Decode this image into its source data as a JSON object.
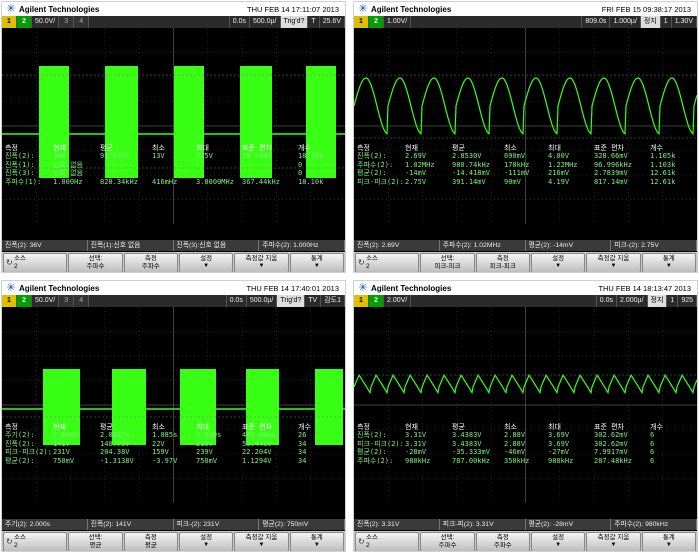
{
  "brand": "Agilent Technologies",
  "screens": [
    {
      "datetime": "THU FEB 14 17:11:07 2013",
      "status": {
        "ch1": "1",
        "ch2": "2",
        "ch2_scale": "50.0V/",
        "ch3": "3",
        "ch4": "4",
        "trig_delay": "0.0s",
        "timebase": "500.0",
        "timebase_unit": "µ/",
        "trig": "Trig'd?",
        "ch_icon": "T",
        "right": "25.6V"
      },
      "measure": {
        "header": [
          "측정",
          "현재",
          "평균",
          "최소",
          "최대",
          "표준 편차",
          "개수"
        ],
        "rows": [
          [
            "진폭(2):",
            "36V",
            "91.425V",
            "13V",
            "225V",
            "19.730V",
            "18.95k"
          ],
          [
            "진폭(1):",
            "신호 없음",
            "",
            "",
            "",
            "",
            "0"
          ],
          [
            "진폭(3):",
            "신호 없음",
            "",
            "",
            "",
            "",
            "0"
          ],
          [
            "주파수(1):",
            "1.000Hz",
            "828.34kHz",
            "416mHz",
            "3.8000MHz",
            "367.44kHz",
            "18.10k"
          ]
        ]
      },
      "readout": [
        "진폭(2): 36V",
        "진폭(1):신호 없음",
        "진폭(3):신호 없음",
        "주파수(2): 1.000Hz"
      ],
      "softkeys": [
        {
          "l1": "소스",
          "l2": "2"
        },
        {
          "l1": "선택:",
          "l2": "주파수"
        },
        {
          "l1": "측정",
          "l2": "주파수"
        },
        {
          "l1": "설정",
          "l2": ""
        },
        {
          "l1": "측정값 지움",
          "l2": ""
        },
        {
          "l1": "통계",
          "l2": ""
        }
      ]
    },
    {
      "datetime": "FRI FEB 15 09:38:17 2013",
      "status": {
        "ch1": "1",
        "ch2": "2",
        "ch2_scale": "1.00V/",
        "ch3": "",
        "ch4": "",
        "trig_delay": "809.0s",
        "timebase": "1.000",
        "timebase_unit": "µ/",
        "trig": "정지",
        "ch_icon": "1",
        "right": "1.30V"
      },
      "measure": {
        "header": [
          "측정",
          "현재",
          "평균",
          "최소",
          "최대",
          "표준 편차",
          "개수"
        ],
        "rows": [
          [
            "진폭(2):",
            "2.69V",
            "2.8530V",
            "690mV",
            "4.00V",
            "328.66mV",
            "1.105k"
          ],
          [
            "주파수(2):",
            "1.02MHz",
            "980.74kHz",
            "170kHz",
            "1.22MHz",
            "96.996kHz",
            "1.103k"
          ],
          [
            "평균(2):",
            "-14mV",
            "-14.418mV",
            "-111mV",
            "216mV",
            "2.7839mV",
            "12.61k"
          ],
          [
            "피크-피크(2):",
            "2.75V",
            "391.14mV",
            "90mV",
            "4.19V",
            "817.14mV",
            "12.61k"
          ]
        ]
      },
      "readout": [
        "진폭(2): 2.69V",
        "주파수(2): 1.02MHz",
        "평균(2): -14mV",
        "피크-(2): 2.75V"
      ],
      "softkeys": [
        {
          "l1": "소스",
          "l2": "2"
        },
        {
          "l1": "선택:",
          "l2": "피크-피크"
        },
        {
          "l1": "측정",
          "l2": "피크-피크"
        },
        {
          "l1": "설정",
          "l2": ""
        },
        {
          "l1": "측정값 지움",
          "l2": ""
        },
        {
          "l1": "통계",
          "l2": ""
        }
      ]
    },
    {
      "datetime": "THU FEB 14 17:40:01 2013",
      "status": {
        "ch1": "1",
        "ch2": "2",
        "ch2_scale": "50.0V/",
        "ch3": "3",
        "ch4": "4",
        "trig_delay": "0.0s",
        "timebase": "500.0",
        "timebase_unit": "µ/",
        "trig": "Trig'd?",
        "ch_icon": "TV",
        "right": "감도1"
      },
      "measure": {
        "header": [
          "측정",
          "현재",
          "평균",
          "최소",
          "최대",
          "표준 편차",
          "개수"
        ],
        "rows": [
          [
            "주기(2):",
            "2.000s",
            "2.0827s",
            "1.085s",
            "3.010s",
            "403.06ms",
            "26"
          ],
          [
            "진폭(2):",
            "141V",
            "140.79V",
            "22V",
            "219V",
            "55.445V",
            "34"
          ],
          [
            "피크-피크(2):",
            "231V",
            "204.38V",
            "159V",
            "239V",
            "22.204V",
            "34"
          ],
          [
            "평균(2):",
            "750mV",
            "-1.3138V",
            "-3.97V",
            "750mV",
            "1.1294V",
            "34"
          ]
        ]
      },
      "readout": [
        "주기(2): 2.000s",
        "진폭(2): 141V",
        "피크-(2): 231V",
        "평균(2): 750mV"
      ],
      "softkeys": [
        {
          "l1": "소스",
          "l2": "2"
        },
        {
          "l1": "선택:",
          "l2": "평균"
        },
        {
          "l1": "측정",
          "l2": "평균"
        },
        {
          "l1": "설정",
          "l2": ""
        },
        {
          "l1": "측정값 지움",
          "l2": ""
        },
        {
          "l1": "통계",
          "l2": ""
        }
      ]
    },
    {
      "datetime": "THU FEB 14 18:13:47 2013",
      "status": {
        "ch1": "1",
        "ch2": "2",
        "ch2_scale": "2.00V/",
        "ch3": "",
        "ch4": "",
        "trig_delay": "0.0s",
        "timebase": "2.000",
        "timebase_unit": "µ/",
        "trig": "정지",
        "ch_icon": "1",
        "right": "925"
      },
      "measure": {
        "header": [
          "측정",
          "현재",
          "평균",
          "최소",
          "최대",
          "표준 편차",
          "개수"
        ],
        "rows": [
          [
            "진폭(2):",
            "3.31V",
            "3.4383V",
            "2.88V",
            "3.69V",
            "302.62mV",
            "6"
          ],
          [
            "피크-피크(2):",
            "3.31V",
            "3.4383V",
            "2.88V",
            "3.69V",
            "302.62mV",
            "6"
          ],
          [
            "평균(2):",
            "-28mV",
            "-35.333mV",
            "-46mV",
            "-27mV",
            "7.9917mV",
            "6"
          ],
          [
            "주파수(2):",
            "980kHz",
            "787.00kHz",
            "350kHz",
            "980kHz",
            "287.48kHz",
            "6"
          ]
        ]
      },
      "readout": [
        "진폭(2): 3.31V",
        "피크-피(2): 3.31V",
        "평균(2): -28mV",
        "주파수(2): 980kHz"
      ],
      "softkeys": [
        {
          "l1": "소스",
          "l2": "2"
        },
        {
          "l1": "선택:",
          "l2": "주파수"
        },
        {
          "l1": "측정",
          "l2": "주파수"
        },
        {
          "l1": "설정",
          "l2": ""
        },
        {
          "l1": "측정값 지움",
          "l2": ""
        },
        {
          "l1": "통계",
          "l2": ""
        }
      ]
    }
  ],
  "colors": {
    "trace": "#39ff14",
    "grid": "#555555",
    "ch1": "#e0c000",
    "ch2": "#00a000"
  }
}
